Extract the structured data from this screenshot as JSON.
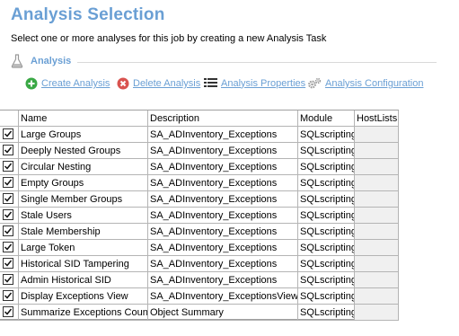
{
  "header": {
    "title": "Analysis Selection",
    "subtitle": "Select one or more analyses for this job by creating a new Analysis Task"
  },
  "section": {
    "label": "Analysis",
    "icon": "flask-icon"
  },
  "toolbar": {
    "create_label": "Create Analysis",
    "delete_label": "Delete Analysis",
    "properties_label": "Analysis Properties",
    "configuration_label": "Analysis Configuration"
  },
  "grid": {
    "columns": [
      "Name",
      "Description",
      "Module",
      "HostLists"
    ],
    "rows": [
      {
        "name": "Large Groups",
        "description": "SA_ADInventory_Exceptions",
        "module": "SQLscripting",
        "hostlists": "",
        "checked": true
      },
      {
        "name": "Deeply Nested Groups",
        "description": "SA_ADInventory_Exceptions",
        "module": "SQLscripting",
        "hostlists": "",
        "checked": true
      },
      {
        "name": "Circular Nesting",
        "description": "SA_ADInventory_Exceptions",
        "module": "SQLscripting",
        "hostlists": "",
        "checked": true
      },
      {
        "name": "Empty Groups",
        "description": "SA_ADInventory_Exceptions",
        "module": "SQLscripting",
        "hostlists": "",
        "checked": true
      },
      {
        "name": "Single Member Groups",
        "description": "SA_ADInventory_Exceptions",
        "module": "SQLscripting",
        "hostlists": "",
        "checked": true
      },
      {
        "name": "Stale Users",
        "description": "SA_ADInventory_Exceptions",
        "module": "SQLscripting",
        "hostlists": "",
        "checked": true
      },
      {
        "name": "Stale Membership",
        "description": "SA_ADInventory_Exceptions",
        "module": "SQLscripting",
        "hostlists": "",
        "checked": true
      },
      {
        "name": "Large Token",
        "description": "SA_ADInventory_Exceptions",
        "module": "SQLscripting",
        "hostlists": "",
        "checked": true
      },
      {
        "name": "Historical SID Tampering",
        "description": "SA_ADInventory_Exceptions",
        "module": "SQLscripting",
        "hostlists": "",
        "checked": true
      },
      {
        "name": "Admin Historical SID",
        "description": "SA_ADInventory_Exceptions",
        "module": "SQLscripting",
        "hostlists": "",
        "checked": true
      },
      {
        "name": "Display Exceptions View",
        "description": "SA_ADInventory_ExceptionsView",
        "module": "SQLscripting",
        "hostlists": "",
        "checked": true
      },
      {
        "name": "Summarize Exceptions Count",
        "description": "Object Summary",
        "module": "SQLscripting",
        "hostlists": "",
        "checked": true
      }
    ]
  },
  "colors": {
    "accent": "#6a9fd4",
    "create": "#3aa845",
    "delete": "#d9534f"
  }
}
